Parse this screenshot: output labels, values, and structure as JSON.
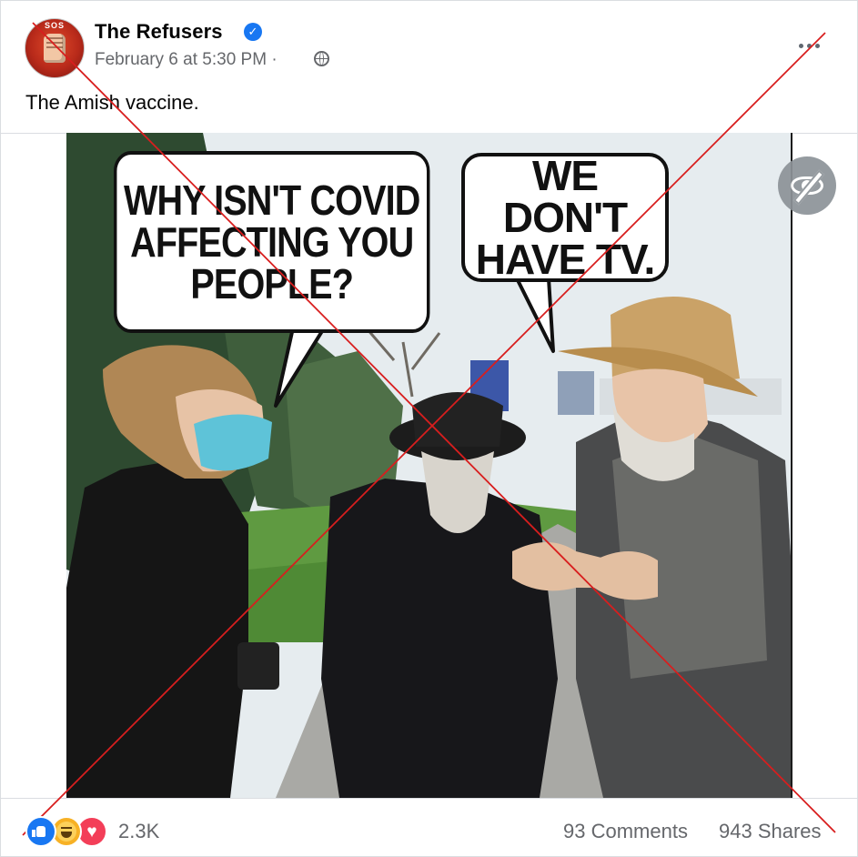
{
  "post": {
    "author": "The Refusers",
    "avatar_text": "SOS",
    "verified_icon": "check",
    "timestamp": "February 6 at 5:30 PM",
    "meta_separator": "·",
    "audience_icon": "globe-icon",
    "caption": "The Amish vaccine."
  },
  "image": {
    "bubble_left": "WHY ISN'T COVID\nAFFECTING YOU\nPEOPLE?",
    "bubble_right": "WE DON'T\nHAVE TV.",
    "overlay_icon": "eye-slash-icon"
  },
  "footer": {
    "reaction_icons": [
      "like-icon",
      "haha-icon",
      "love-icon"
    ],
    "reaction_count": "2.3K",
    "comments": "93 Comments",
    "shares": "943 Shares"
  },
  "colors": {
    "brand_blue": "#1877f2",
    "secondary_text": "#65676b",
    "cross_red": "#d81e1e"
  }
}
